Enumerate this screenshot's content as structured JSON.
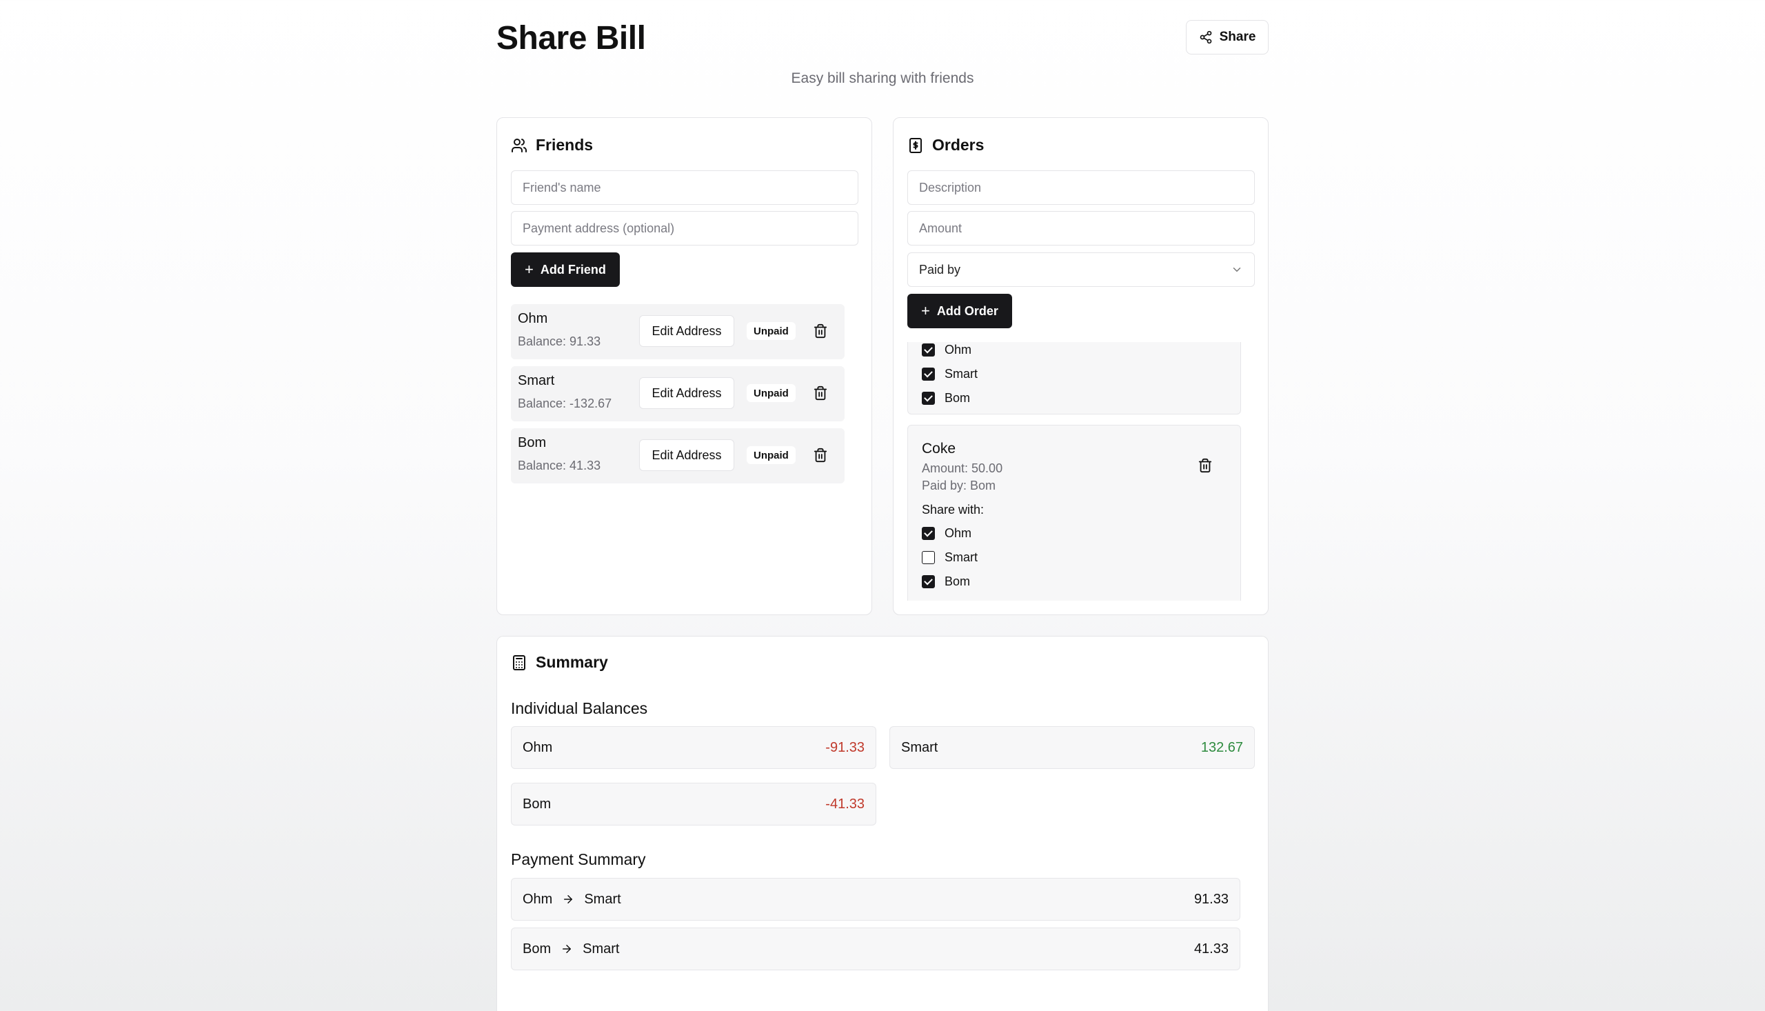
{
  "header": {
    "title": "Share Bill",
    "share_label": "Share",
    "subtitle": "Easy bill sharing with friends"
  },
  "friends": {
    "title": "Friends",
    "name_placeholder": "Friend's name",
    "address_placeholder": "Payment address (optional)",
    "add_label": "Add Friend",
    "edit_label": "Edit Address",
    "list": [
      {
        "name": "Ohm",
        "balance": "Balance: 91.33",
        "status": "Unpaid"
      },
      {
        "name": "Smart",
        "balance": "Balance: -132.67",
        "status": "Unpaid"
      },
      {
        "name": "Bom",
        "balance": "Balance: 41.33",
        "status": "Unpaid"
      }
    ]
  },
  "orders": {
    "title": "Orders",
    "description_placeholder": "Description",
    "amount_placeholder": "Amount",
    "paid_by_label": "Paid by",
    "add_label": "Add Order",
    "items": [
      {
        "share": [
          {
            "name": "Ohm",
            "checked": true
          },
          {
            "name": "Smart",
            "checked": true
          },
          {
            "name": "Bom",
            "checked": true
          }
        ]
      },
      {
        "name": "Coke",
        "amount": "Amount: 50.00",
        "paid_by": "Paid by: Bom",
        "share_with_label": "Share with:",
        "share": [
          {
            "name": "Ohm",
            "checked": true
          },
          {
            "name": "Smart",
            "checked": false
          },
          {
            "name": "Bom",
            "checked": true
          }
        ]
      }
    ]
  },
  "summary": {
    "title": "Summary",
    "balances_title": "Individual Balances",
    "balances": [
      {
        "name": "Ohm",
        "value": "-91.33"
      },
      {
        "name": "Smart",
        "value": "132.67"
      },
      {
        "name": "Bom",
        "value": "-41.33"
      }
    ],
    "payments_title": "Payment Summary",
    "payments": [
      {
        "from": "Ohm",
        "to": "Smart",
        "amount": "91.33"
      },
      {
        "from": "Bom",
        "to": "Smart",
        "amount": "41.33"
      }
    ]
  },
  "colors": {
    "dark": "#18181b",
    "negative": "#c0392b",
    "positive": "#2e8b3e"
  }
}
